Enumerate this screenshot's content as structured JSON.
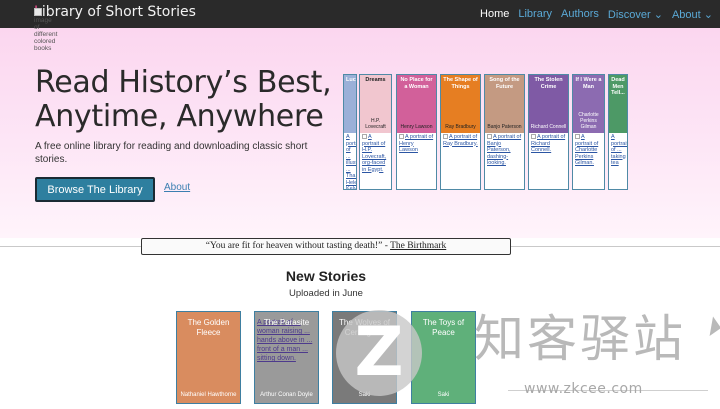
{
  "brand": {
    "first_letter": "L",
    "rest": "ibrary of Short Stories",
    "logo_alt": "image of different colored books"
  },
  "nav": {
    "items": [
      {
        "label": "Home",
        "active": true
      },
      {
        "label": "Library"
      },
      {
        "label": "Authors"
      },
      {
        "label": "Discover ⌄"
      },
      {
        "label": "About ⌄"
      }
    ]
  },
  "hero": {
    "title": "Read History’s Best, Anytime, Anywhere",
    "subtitle": "A free online library for reading and downloading classic short stories.",
    "browse_button": "Browse The Library",
    "about_link": "About",
    "books": [
      {
        "title": "Lucky...",
        "author": "",
        "color": "#9bb0d8",
        "alt": "A portrait of ... illustrating ... Tha... Hele... Kely"
      },
      {
        "title": "Dreams",
        "author": "H.P. Lovecraft",
        "color": "#f1c6cf",
        "alt": "A portrait of H.P. Lovecraft, org-faced in Egypt."
      },
      {
        "title": "No Place for a Woman",
        "author": "Henry Lawson",
        "color": "#d2609a",
        "alt": "A portrait of Henry Lawson"
      },
      {
        "title": "The Shape of Things",
        "author": "Ray Bradbury",
        "color": "#e67e22",
        "alt": "A portrait of Ray Bradbury."
      },
      {
        "title": "Song of the Future",
        "author": "Banjo Paterson",
        "color": "#c49a82",
        "alt": "A portrait of Banjo Paterson, dashing-looking."
      },
      {
        "title": "The Stolen Crime",
        "author": "Richard Connell",
        "color": "#7f5aa5",
        "alt": "A portrait of Richard Connell."
      },
      {
        "title": "If I Were a Man",
        "author": "Charlotte Perkins Gilman",
        "color": "#8c6bb1",
        "alt": "A portrait of Charlotte Perkins Gilman."
      },
      {
        "title": "Dead Men Tell...",
        "author": "",
        "color": "#4d9966",
        "alt": "A portrait of ... taking tea"
      }
    ]
  },
  "quote": {
    "text": "“You are fit for heaven without tasting death!” - ",
    "source": "The Birthmark"
  },
  "new_stories": {
    "title": "New Stories",
    "subtitle": "Uploaded in June",
    "cards": [
      {
        "title": "The Golden Fleece",
        "author": "Nathaniel Hawthorne",
        "color": "#d98c5f"
      },
      {
        "title": "The Parasite",
        "author": "Arthur Conan Doyle",
        "color": "#9a9a9a",
        "alt": "A portrait of ... woman raising ... hands above in ... front of a man ... sitting down."
      },
      {
        "title": "The Wolves of Cernogratz",
        "author": "Saki",
        "color": "#7a7a7a"
      },
      {
        "title": "The Toys of Peace",
        "author": "Saki",
        "color": "#5fb07a"
      }
    ]
  },
  "watermark": {
    "text": "知客驿站",
    "url": "www.zkcee.com"
  }
}
